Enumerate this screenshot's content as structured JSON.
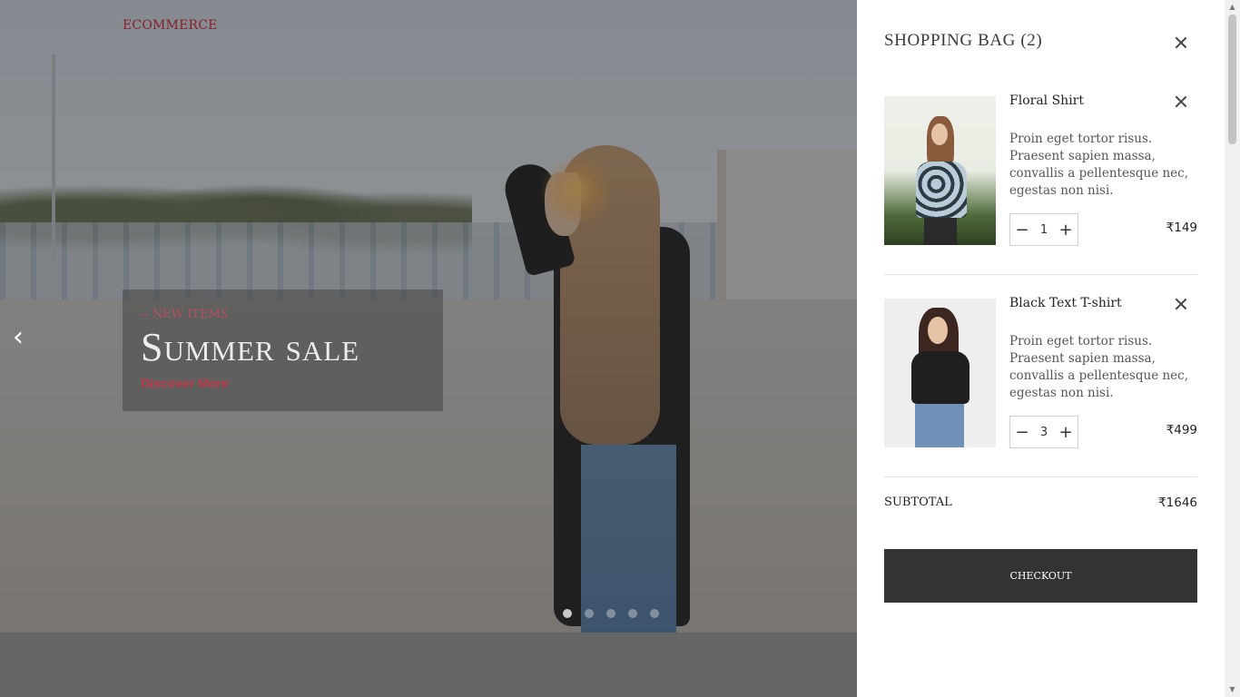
{
  "header": {
    "logo": "ECOMMERCE"
  },
  "hero": {
    "tag": "-- NEW ITEMS",
    "title": "Summer sale",
    "cta": "Discover More",
    "slides_count": 5,
    "active_slide": 1
  },
  "cart": {
    "title": "SHOPPING BAG (2)",
    "items": [
      {
        "name": "Floral Shirt",
        "description": "Proin eget tortor risus. Praesent sapien massa, convallis a pellentesque nec, egestas non nisi.",
        "quantity": "1",
        "price": "₹149",
        "minus": "−",
        "plus": "+"
      },
      {
        "name": "Black Text T-shirt",
        "description": "Proin eget tortor risus. Praesent sapien massa, convallis a pellentesque nec, egestas non nisi.",
        "quantity": "3",
        "price": "₹499",
        "minus": "−",
        "plus": "+"
      }
    ],
    "subtotal_label": "SUBTOTAL",
    "subtotal_value": "₹1646",
    "checkout_label": "CHECKOUT"
  },
  "icons": {
    "prev": "‹",
    "close": "close-icon",
    "scroll_up": "▲",
    "scroll_down": "▼"
  },
  "colors": {
    "brand": "#8a1f2b",
    "accent": "#c0394b",
    "checkout_bg": "#333333"
  }
}
